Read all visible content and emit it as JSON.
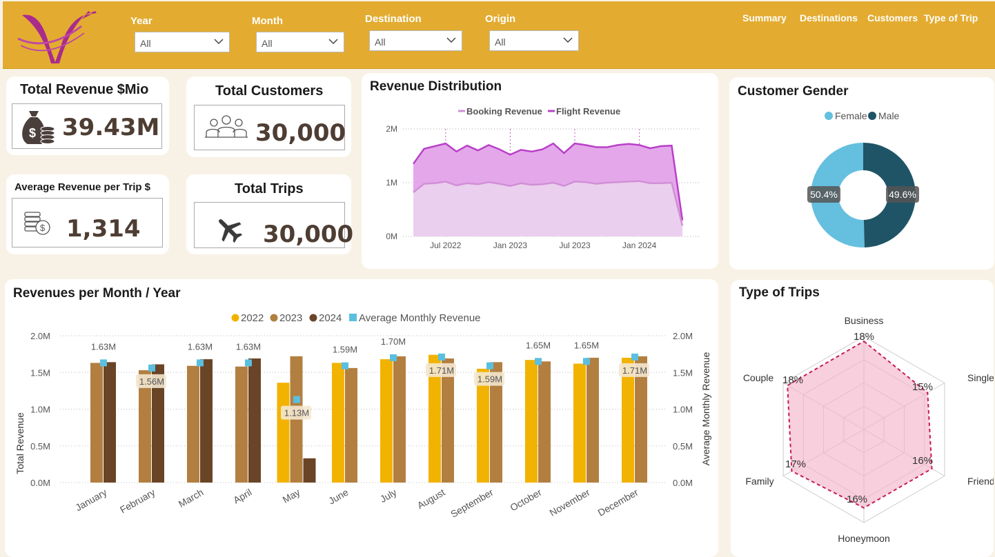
{
  "header": {
    "filters": [
      {
        "label": "Year",
        "value": "All"
      },
      {
        "label": "Month",
        "value": "All"
      },
      {
        "label": "Destination",
        "value": "All"
      },
      {
        "label": "Origin",
        "value": "All"
      }
    ],
    "nav": [
      "Summary",
      "Destinations",
      "Customers",
      "Type of Trip"
    ]
  },
  "kpis": {
    "total_revenue": {
      "title": "Total Revenue $Mio",
      "value": "39.43M"
    },
    "total_customers": {
      "title": "Total Customers",
      "value": "30,000"
    },
    "avg_revenue": {
      "title": "Average Revenue per Trip $",
      "value": "1,314"
    },
    "total_trips": {
      "title": "Total Trips",
      "value": "30,000"
    }
  },
  "revenue_distribution": {
    "title": "Revenue Distribution",
    "legend": [
      "Booking Revenue",
      "Flight Revenue"
    ],
    "colors": {
      "booking": "#d18fd6",
      "flight": "#b93fc8"
    },
    "y_ticks": [
      "2M",
      "1M",
      "0M"
    ],
    "x_ticks": [
      "Jul 2022",
      "Jan 2023",
      "Jul 2023",
      "Jan 2024"
    ]
  },
  "customer_gender": {
    "title": "Customer Gender",
    "legend": [
      "Female",
      "Male"
    ],
    "colors": {
      "female": "#65bfdf",
      "male": "#1f5466"
    },
    "labels": [
      "50.4%",
      "49.6%"
    ]
  },
  "revenues_month": {
    "title": "Revenues per Month / Year",
    "legend": [
      "2022",
      "2023",
      "2024",
      "Average Monthly Revenue"
    ],
    "colors": {
      "y2022": "#f2b300",
      "y2023": "#b27f41",
      "y2024": "#6a4426",
      "avg": "#5bbfdf"
    },
    "y_left_label": "Total Revenue",
    "y_right_label": "Average Monthly Revenue",
    "y_ticks": [
      "2.0M",
      "1.5M",
      "1.0M",
      "0.5M",
      "0.0M"
    ],
    "avg_labels": [
      "1.63M",
      "1.56M",
      "1.63M",
      "1.63M",
      "1.13M",
      "1.59M",
      "1.70M",
      "1.71M",
      "1.59M",
      "1.65M",
      "1.65M",
      "1.71M"
    ]
  },
  "type_of_trips": {
    "title": "Type of Trips",
    "axes": [
      "Business",
      "Single",
      "Friends",
      "Honeymoon",
      "Family",
      "Couple"
    ],
    "values": [
      "18%",
      "15%",
      "16%",
      "16%",
      "17%",
      "18%"
    ]
  },
  "chart_data": [
    {
      "type": "area",
      "title": "Revenue Distribution",
      "x": [
        "2022-04",
        "2022-05",
        "2022-06",
        "2022-07",
        "2022-08",
        "2022-09",
        "2022-10",
        "2022-11",
        "2022-12",
        "2023-01",
        "2023-02",
        "2023-03",
        "2023-04",
        "2023-05",
        "2023-06",
        "2023-07",
        "2023-08",
        "2023-09",
        "2023-10",
        "2023-11",
        "2023-12",
        "2024-01",
        "2024-02",
        "2024-03",
        "2024-04",
        "2024-05"
      ],
      "series": [
        {
          "name": "Booking Revenue",
          "values": [
            0.82,
            0.98,
            0.99,
            1.02,
            0.95,
            0.99,
            0.97,
            1.01,
            0.98,
            0.94,
            0.99,
            0.96,
            0.97,
            1.0,
            0.94,
            1.02,
            1.01,
            0.98,
            1.0,
            1.01,
            1.02,
            1.03,
            0.99,
            0.99,
            1.0,
            0.2
          ]
        },
        {
          "name": "Flight Revenue",
          "values": [
            1.35,
            1.63,
            1.68,
            1.73,
            1.58,
            1.69,
            1.6,
            1.7,
            1.62,
            1.52,
            1.61,
            1.58,
            1.62,
            1.73,
            1.55,
            1.73,
            1.7,
            1.66,
            1.66,
            1.7,
            1.72,
            1.7,
            1.64,
            1.68,
            1.69,
            0.3
          ]
        }
      ],
      "ylim": [
        0,
        2
      ]
    },
    {
      "type": "pie",
      "title": "Customer Gender",
      "categories": [
        "Female",
        "Male"
      ],
      "values": [
        50.4,
        49.6
      ]
    },
    {
      "type": "bar",
      "title": "Revenues per Month / Year",
      "categories": [
        "January",
        "February",
        "March",
        "April",
        "May",
        "June",
        "July",
        "August",
        "September",
        "October",
        "November",
        "December"
      ],
      "series": [
        {
          "name": "2022",
          "values": [
            null,
            null,
            null,
            null,
            1.36,
            1.63,
            1.68,
            1.74,
            1.55,
            1.67,
            1.62,
            1.7
          ]
        },
        {
          "name": "2023",
          "values": [
            1.63,
            1.53,
            1.59,
            1.58,
            1.72,
            1.56,
            1.72,
            1.69,
            1.64,
            1.65,
            1.7,
            1.72
          ]
        },
        {
          "name": "2024",
          "values": [
            1.64,
            1.61,
            1.68,
            1.69,
            0.33,
            null,
            null,
            null,
            null,
            null,
            null,
            null
          ]
        },
        {
          "name": "Average Monthly Revenue",
          "values": [
            1.63,
            1.56,
            1.63,
            1.63,
            1.13,
            1.59,
            1.7,
            1.71,
            1.59,
            1.65,
            1.65,
            1.71
          ]
        }
      ],
      "ylim": [
        0,
        2
      ],
      "xlabel": "",
      "ylabel": "Total Revenue"
    },
    {
      "type": "radar",
      "title": "Type of Trips",
      "categories": [
        "Business",
        "Single",
        "Friends",
        "Honeymoon",
        "Family",
        "Couple"
      ],
      "values": [
        18,
        15,
        16,
        16,
        17,
        18
      ]
    }
  ]
}
